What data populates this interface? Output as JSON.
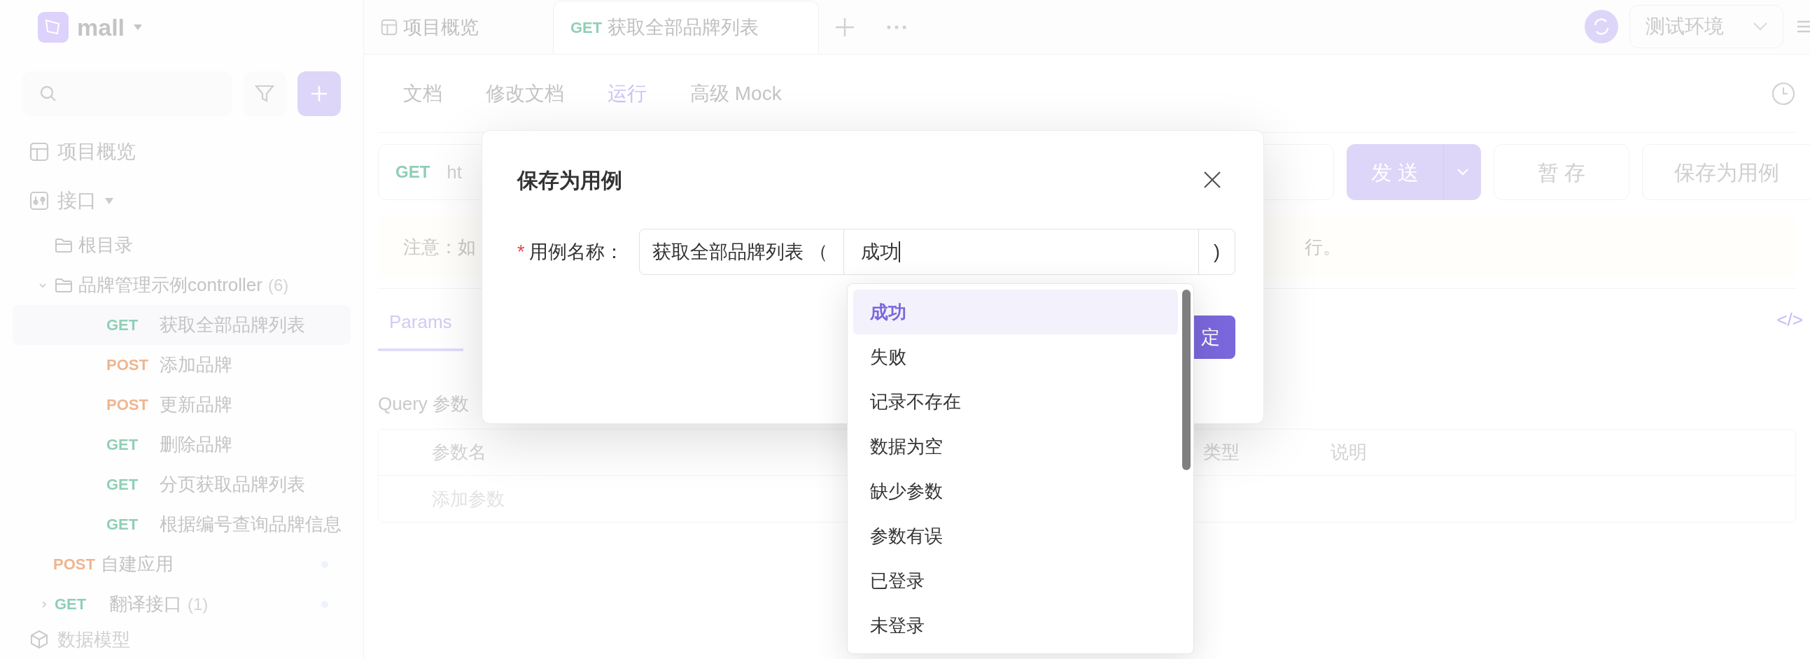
{
  "project": {
    "name": "mall"
  },
  "sidebar": {
    "nav": [
      {
        "label": "项目概览",
        "kind": "overview"
      },
      {
        "label": "接口",
        "kind": "api"
      }
    ],
    "tree": [
      {
        "kind": "folder",
        "label": "根目录"
      },
      {
        "kind": "folder",
        "label": "品牌管理示例controller",
        "count": "(6)",
        "expanded": true,
        "children": [
          {
            "method": "GET",
            "label": "获取全部品牌列表",
            "selected": true
          },
          {
            "method": "POST",
            "label": "添加品牌",
            "selected": false
          },
          {
            "method": "POST",
            "label": "更新品牌",
            "selected": false
          },
          {
            "method": "GET",
            "label": "删除品牌",
            "selected": false
          },
          {
            "method": "GET",
            "label": "分页获取品牌列表",
            "selected": false
          },
          {
            "method": "GET",
            "label": "根据编号查询品牌信息",
            "selected": false
          }
        ]
      },
      {
        "kind": "api",
        "method": "POST",
        "label": "自建应用"
      },
      {
        "kind": "group",
        "method": "GET",
        "label": "翻译接口",
        "count": "(1)",
        "expanded": false
      }
    ],
    "footer": "数据模型"
  },
  "tabs": [
    {
      "kind": "overview",
      "label": "项目概览",
      "selected": false
    },
    {
      "kind": "api",
      "method": "GET",
      "label": "获取全部品牌列表",
      "selected": true
    }
  ],
  "environment": "测试环境",
  "subtabs": [
    {
      "label": "文档",
      "selected": false
    },
    {
      "label": "修改文档",
      "selected": false
    },
    {
      "label": "运行",
      "selected": true
    },
    {
      "label": "高级 Mock",
      "selected": false
    }
  ],
  "request": {
    "method": "GET",
    "url": "ht",
    "send": "发 送",
    "stash": "暂 存",
    "save_case": "保存为用例"
  },
  "notice": {
    "start": "注意：如",
    "end": "行。"
  },
  "params_tabs": [
    {
      "label": "Params",
      "selected": true
    }
  ],
  "code_toggle": "</>",
  "query": {
    "label": "Query 参数",
    "columns": [
      "参数名",
      "类型",
      "说明"
    ],
    "placeholder": "添加参数"
  },
  "dialog": {
    "title": "保存为用例",
    "field_label": "用例名称：",
    "required_mark": "*",
    "prefix": "获取全部品牌列表 （",
    "value": "成功",
    "suffix": ")",
    "confirm": "定"
  },
  "dropdown": [
    {
      "label": "成功",
      "selected": true
    },
    {
      "label": "失败",
      "selected": false
    },
    {
      "label": "记录不存在",
      "selected": false
    },
    {
      "label": "数据为空",
      "selected": false
    },
    {
      "label": "缺少参数",
      "selected": false
    },
    {
      "label": "参数有误",
      "selected": false
    },
    {
      "label": "已登录",
      "selected": false
    },
    {
      "label": "未登录",
      "selected": false
    }
  ]
}
